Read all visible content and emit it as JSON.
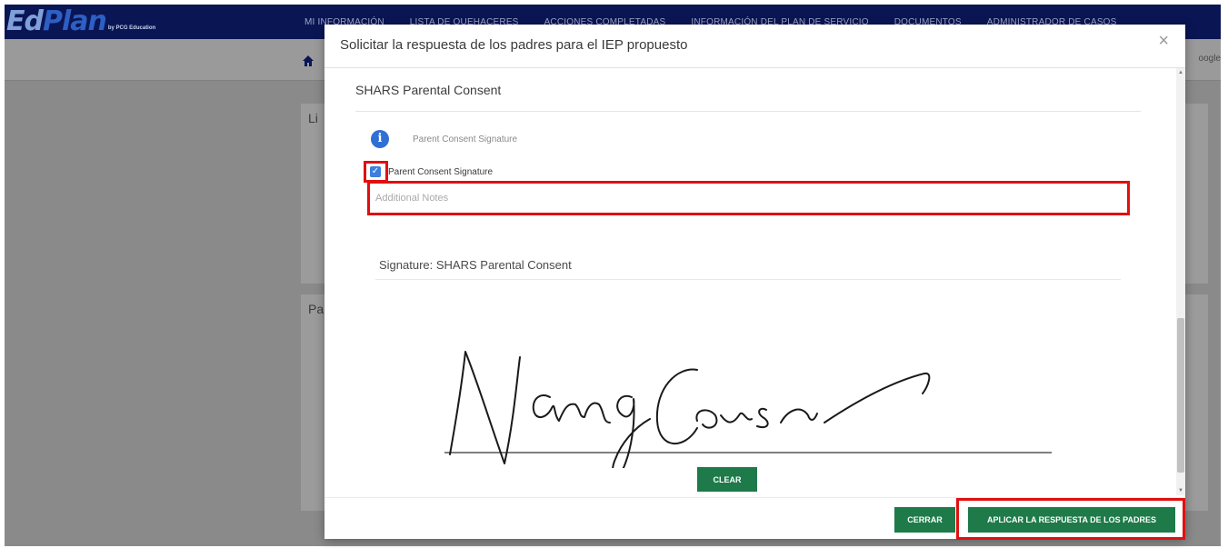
{
  "app": {
    "logo_ed": "Ed",
    "logo_plan": "Plan",
    "logo_by": "by PCG Education",
    "nav": [
      "MI INFORMACIÓN",
      "LISTA DE QUEHACERES",
      "ACCIONES COMPLETADAS",
      "INFORMACIÓN DEL PLAN DE SERVICIO",
      "DOCUMENTOS",
      "ADMINISTRADOR DE CASOS"
    ],
    "google_text": "oogle",
    "card_labels": [
      "Li",
      "Pa"
    ]
  },
  "dialog": {
    "title": "Solicitar la respuesta de los padres para el IEP propuesto",
    "close_symbol": "×",
    "section_title": "SHARS Parental Consent",
    "info_text": "Parent Consent Signature",
    "checkbox_label": "Parent Consent Signature",
    "checkbox_checked": true,
    "notes_placeholder": "Additional Notes",
    "notes_value": "",
    "signature_title": "Signature: SHARS Parental Consent",
    "clear_label": "CLEAR",
    "cerrar_label": "CERRAR",
    "apply_label": "APLICAR LA RESPUESTA DE LOS PADRES"
  },
  "colors": {
    "nav_bg": "#0a1554",
    "button_green": "#1e7a49",
    "highlight_red": "#e01010",
    "info_blue": "#2f6fd6",
    "checkbox_blue": "#3b7fe0"
  },
  "icons": {
    "home": "home-icon",
    "info": "info-icon",
    "close": "close-icon",
    "check": "check-icon"
  }
}
